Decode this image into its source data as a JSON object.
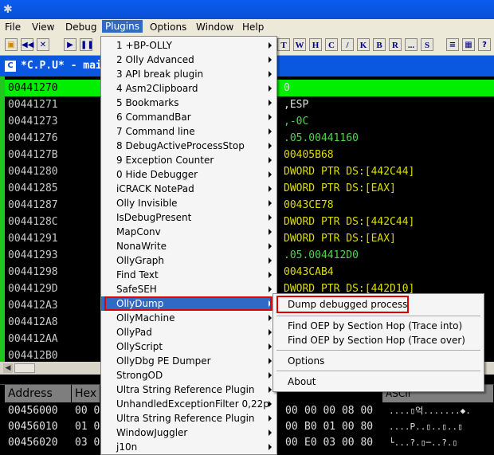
{
  "menubar": {
    "items": [
      "File",
      "View",
      "Debug",
      "Plugins",
      "Options",
      "Window",
      "Help"
    ]
  },
  "toolbar": {
    "letters": [
      "T",
      "W",
      "H",
      "C",
      "/",
      "K",
      "B",
      "R",
      "...",
      "S"
    ]
  },
  "cpu_window": {
    "title": "*C.P.U* - mai"
  },
  "disasm": {
    "rows": [
      {
        "addr": "00441270",
        "instr": "0"
      },
      {
        "addr": "00441271",
        "instr": ",ESP"
      },
      {
        "addr": "00441273",
        "instr": ",-0C"
      },
      {
        "addr": "00441276",
        "instr": ".05.00441160"
      },
      {
        "addr": "0044127B",
        "instr": "00405B68"
      },
      {
        "addr": "00441280",
        "instr": "DWORD PTR DS:[442C44]"
      },
      {
        "addr": "00441285",
        "instr": "DWORD PTR DS:[EAX]"
      },
      {
        "addr": "00441287",
        "instr": "0043CE78"
      },
      {
        "addr": "0044128C",
        "instr": "DWORD PTR DS:[442C44]"
      },
      {
        "addr": "00441291",
        "instr": "DWORD PTR DS:[EAX]"
      },
      {
        "addr": "00441293",
        "instr": ".05.004412D0"
      },
      {
        "addr": "00441298",
        "instr": "0043CAB4"
      },
      {
        "addr": "0044129D",
        "instr": "DWORD PTR DS:[442D10]"
      },
      {
        "addr": "004412A3",
        "instr": ""
      },
      {
        "addr": "004412A8",
        "instr": ""
      },
      {
        "addr": "004412AA",
        "instr": ""
      },
      {
        "addr": "004412B0",
        "instr": ""
      }
    ]
  },
  "dump": {
    "headers": {
      "address": "Address",
      "hex": "Hex",
      "ascii": "ASCII"
    },
    "rows": [
      {
        "addr": "00456000",
        "hex1": "00 0",
        "hex2": "00",
        "hex3": "00 00 08 00",
        "ascii": "....▯억.......◆."
      },
      {
        "addr": "00456010",
        "hex1": "01 0",
        "hex2": "00",
        "hex3": "B0 01 00 80",
        "ascii": "....P..▯..▯..▯"
      },
      {
        "addr": "00456020",
        "hex1": "03 0",
        "hex2": "00",
        "hex3": "E0 03 00 80",
        "ascii": "└...?.▯─..?.▯"
      }
    ]
  },
  "plugins_menu": {
    "items": [
      {
        "label": "1 +BP-OLLY",
        "submenu": true
      },
      {
        "label": "2 Olly Advanced",
        "submenu": true
      },
      {
        "label": "3 API break plugin",
        "submenu": true
      },
      {
        "label": "4 Asm2Clipboard",
        "submenu": true
      },
      {
        "label": "5 Bookmarks",
        "submenu": true
      },
      {
        "label": "6 CommandBar",
        "submenu": true
      },
      {
        "label": "7 Command line",
        "submenu": true
      },
      {
        "label": "8 DebugActiveProcessStop",
        "submenu": true
      },
      {
        "label": "9 Exception Counter",
        "submenu": true
      },
      {
        "label": "0 Hide Debugger",
        "submenu": true
      },
      {
        "label": "iCRACK NotePad",
        "submenu": true
      },
      {
        "label": "Olly Invisible",
        "submenu": true
      },
      {
        "label": "IsDebugPresent",
        "submenu": true
      },
      {
        "label": "MapConv",
        "submenu": true
      },
      {
        "label": "NonaWrite",
        "submenu": true
      },
      {
        "label": "OllyGraph",
        "submenu": true
      },
      {
        "label": "Find Text",
        "submenu": true
      },
      {
        "label": "SafeSEH",
        "submenu": true
      },
      {
        "label": "OllyDump",
        "submenu": true
      },
      {
        "label": "OllyMachine",
        "submenu": true
      },
      {
        "label": "OllyPad",
        "submenu": true
      },
      {
        "label": "OllyScript",
        "submenu": true
      },
      {
        "label": "OllyDbg PE Dumper",
        "submenu": true
      },
      {
        "label": "StrongOD",
        "submenu": true
      },
      {
        "label": "Ultra String Reference Plugin",
        "submenu": true
      },
      {
        "label": "UnhandledExceptionFilter 0,22p",
        "submenu": true
      },
      {
        "label": "Ultra String Reference Plugin",
        "submenu": true
      },
      {
        "label": "WindowJuggler",
        "submenu": true
      },
      {
        "label": "j10n",
        "submenu": true
      }
    ]
  },
  "ollydump_submenu": {
    "items": [
      {
        "label": "Dump debugged process"
      },
      {
        "label": "Find OEP by Section Hop (Trace into)"
      },
      {
        "label": "Find OEP by Section Hop (Trace over)"
      },
      {
        "label": "Options"
      },
      {
        "label": "About"
      }
    ]
  },
  "colors": {
    "selection": "#316ac5",
    "highlight_box": "#e00000",
    "disasm_selected_row": "#00ee00"
  }
}
